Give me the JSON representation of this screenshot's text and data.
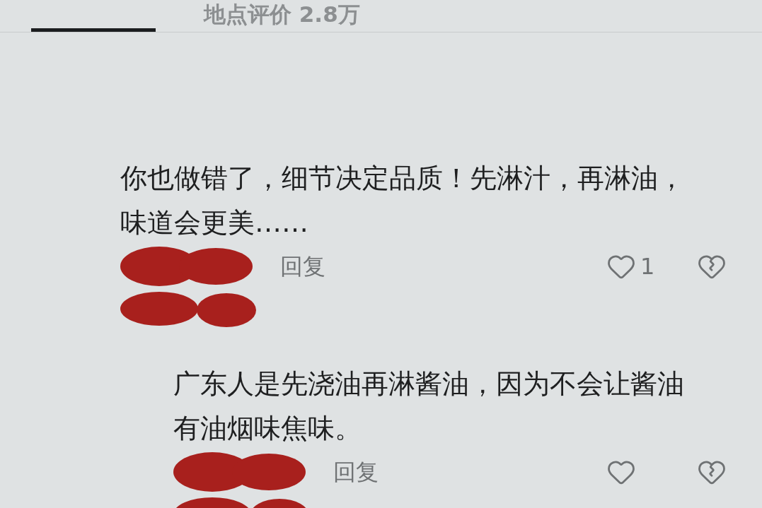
{
  "header": {
    "tab": "地点评价 2.8万"
  },
  "comments": [
    {
      "text": "你也做错了，细节决定品质！先淋汁，再淋油，味道会更美……",
      "reply": "回复",
      "likes": "1",
      "redacted": true,
      "children": [
        {
          "text": "广东人是先浇油再淋酱油，因为不会让酱油有油烟味焦味。",
          "reply": "回复",
          "redacted": true
        }
      ]
    }
  ]
}
